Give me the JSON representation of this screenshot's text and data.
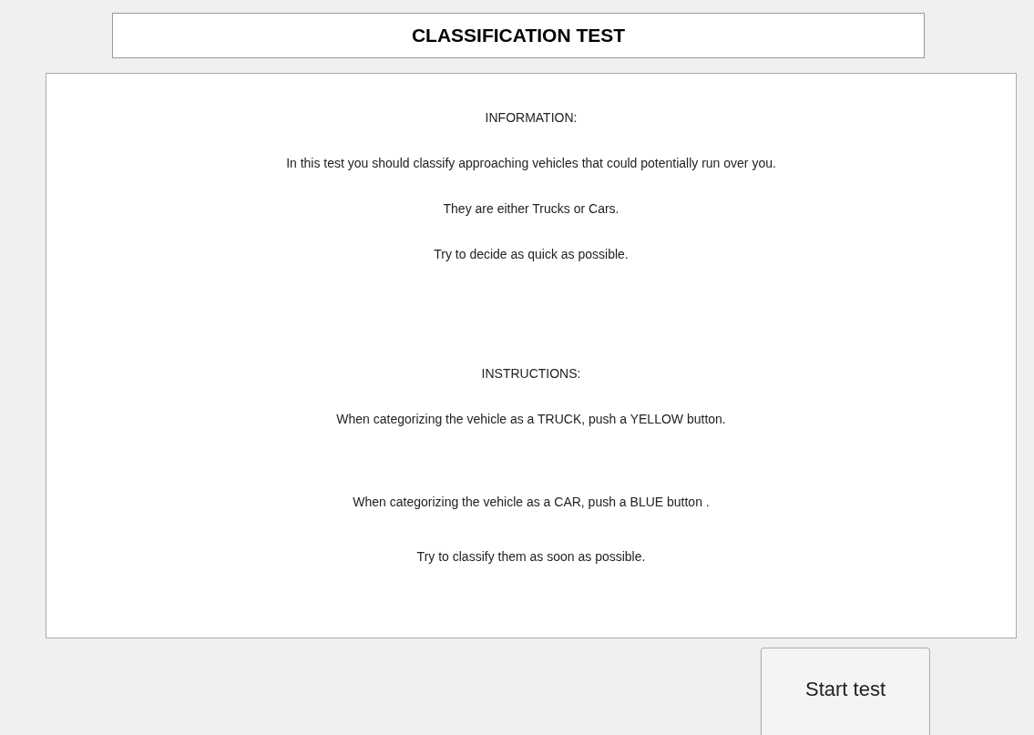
{
  "title": "CLASSIFICATION TEST",
  "sections": [
    {
      "heading": "INFORMATION:",
      "lines": [
        "In this test you should classify approaching vehicles that could potentially run over you.",
        "They are either Trucks or Cars.",
        "Try to decide as quick as possible."
      ]
    },
    {
      "heading": "INSTRUCTIONS:",
      "lines": [
        "When categorizing the vehicle as a TRUCK, push a YELLOW button.",
        "When categorizing the vehicle as a CAR, push a BLUE button .",
        "Try to classify them as soon as possible."
      ]
    }
  ],
  "button": "Start test"
}
